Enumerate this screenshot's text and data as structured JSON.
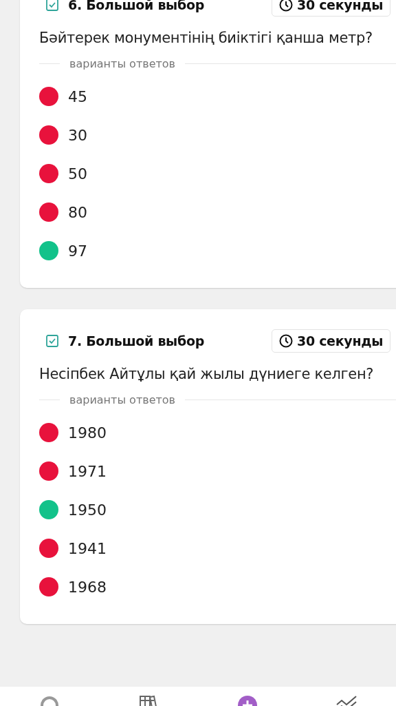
{
  "questions": [
    {
      "title": "6. Большой выбор",
      "checked": true,
      "timer": "30 секунды",
      "question": "Бәйтерек монументінің биіктігі қанша метр?",
      "options_label": "варианты ответов",
      "options": [
        {
          "text": "45",
          "correct": false
        },
        {
          "text": "30",
          "correct": false
        },
        {
          "text": "50",
          "correct": false
        },
        {
          "text": "80",
          "correct": false
        },
        {
          "text": "97",
          "correct": true
        }
      ]
    },
    {
      "title": "7. Большой выбор",
      "checked": true,
      "timer": "30 секунды",
      "question": "Несіпбек Айтұлы қай жылы дүниеге келген?",
      "options_label": "варианты ответов",
      "options": [
        {
          "text": "1980",
          "correct": false
        },
        {
          "text": "1971",
          "correct": false
        },
        {
          "text": "1950",
          "correct": true
        },
        {
          "text": "1941",
          "correct": false
        },
        {
          "text": "1968",
          "correct": false
        }
      ]
    }
  ],
  "bottom_nav": [
    {
      "kind": "search",
      "selected": false
    },
    {
      "kind": "library",
      "selected": false
    },
    {
      "kind": "create",
      "selected": true
    },
    {
      "kind": "reports",
      "selected": false
    }
  ]
}
